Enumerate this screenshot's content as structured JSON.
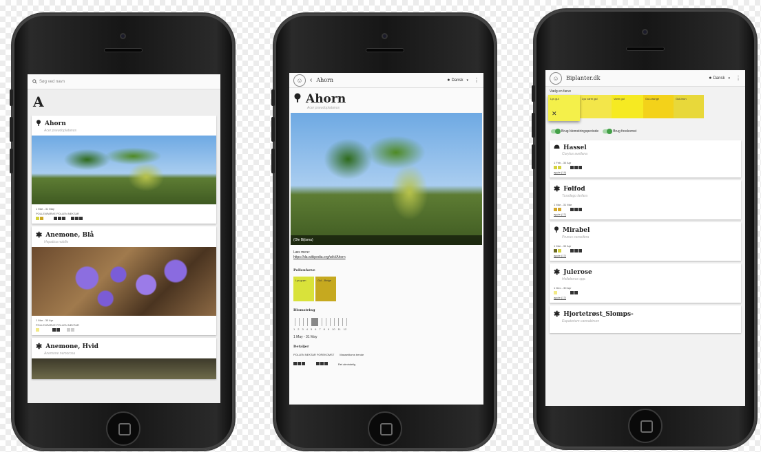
{
  "phone1": {
    "search_placeholder": "Søg ved navn",
    "section_letter": "A",
    "cards": [
      {
        "name": "Ahorn",
        "latin": "Acer pseudoplatanus",
        "dates": "1 Mar - 31 May",
        "legend": "POLLENFARVE  POLLEN  NEKTAR"
      },
      {
        "name": "Anemone, Blå",
        "latin": "Hepatica nobilis",
        "dates": "1 Mar - 30 Apr",
        "legend": "POLLENFARVE  POLLEN  NEKTAR"
      },
      {
        "name": "Anemone, Hvid",
        "latin": "Anemone nemorosa"
      }
    ]
  },
  "phone2": {
    "header_title": "Ahorn",
    "language": "Dansk",
    "plant_name": "Ahorn",
    "latin": "Acer pseudoplatanus",
    "photo_credit": "(Ole Bijlsma)",
    "read_more_label": "Læs mere:",
    "read_more_link": "https://da.wikipedia.org/wiki/Ahorn",
    "pollen_color_label": "Pollenfarve",
    "swatches": [
      {
        "label": "Lys grøn",
        "color": "#d9e23a"
      },
      {
        "label": "Gul - Beige",
        "color": "#c6a91f"
      }
    ],
    "bloom_label": "Blomstring",
    "months": [
      "1",
      "2",
      "3",
      "4",
      "5",
      "6",
      "7",
      "8",
      "9",
      "10",
      "11",
      "12"
    ],
    "bloom_range": "1 May - 31 May",
    "detail_label": "Detaljer",
    "detail_headers": "POLLEN  NEKTAR  FOREKOMST",
    "detail_extra": "Massebloms trende",
    "detail_value": "Ret almindelig"
  },
  "phone3": {
    "header_title": "Biplanter.dk",
    "language": "Dansk",
    "choose_color": "Vælg en farve",
    "color_swatches": [
      {
        "label": "Lys gul",
        "color": "#f4f04a"
      },
      {
        "label": "Lys varm gul",
        "color": "#f3e64a"
      },
      {
        "label": "Varm gul",
        "color": "#f6ea22"
      },
      {
        "label": "Gul-orange",
        "color": "#f3d21a"
      },
      {
        "label": "Gul-brun",
        "color": "#e8d83a"
      }
    ],
    "close_glyph": "✕",
    "toggle1": "Brug blomstringsperiode",
    "toggle2": "Brug forekomst",
    "cards": [
      {
        "name": "Hassel",
        "latin": "Corylus avellana",
        "dates": "1 Feb - 30 Apr",
        "link": "apple (14)"
      },
      {
        "name": "Følfod",
        "latin": "Tussilago farfara",
        "dates": "1 Mar - 31 Mar",
        "link": "apple (17)"
      },
      {
        "name": "Mirabel",
        "latin": "Prunus cerasifera",
        "dates": "1 Mar - 30 Apr",
        "link": "apple (17)"
      },
      {
        "name": "Julerose",
        "latin": "Helleborus spp.",
        "dates": "1 Dec - 30 Apr",
        "link": "apple (17)"
      },
      {
        "name": "Hjortetrøst_Slomps-",
        "latin": "Eupatorium cannabinum"
      }
    ]
  }
}
